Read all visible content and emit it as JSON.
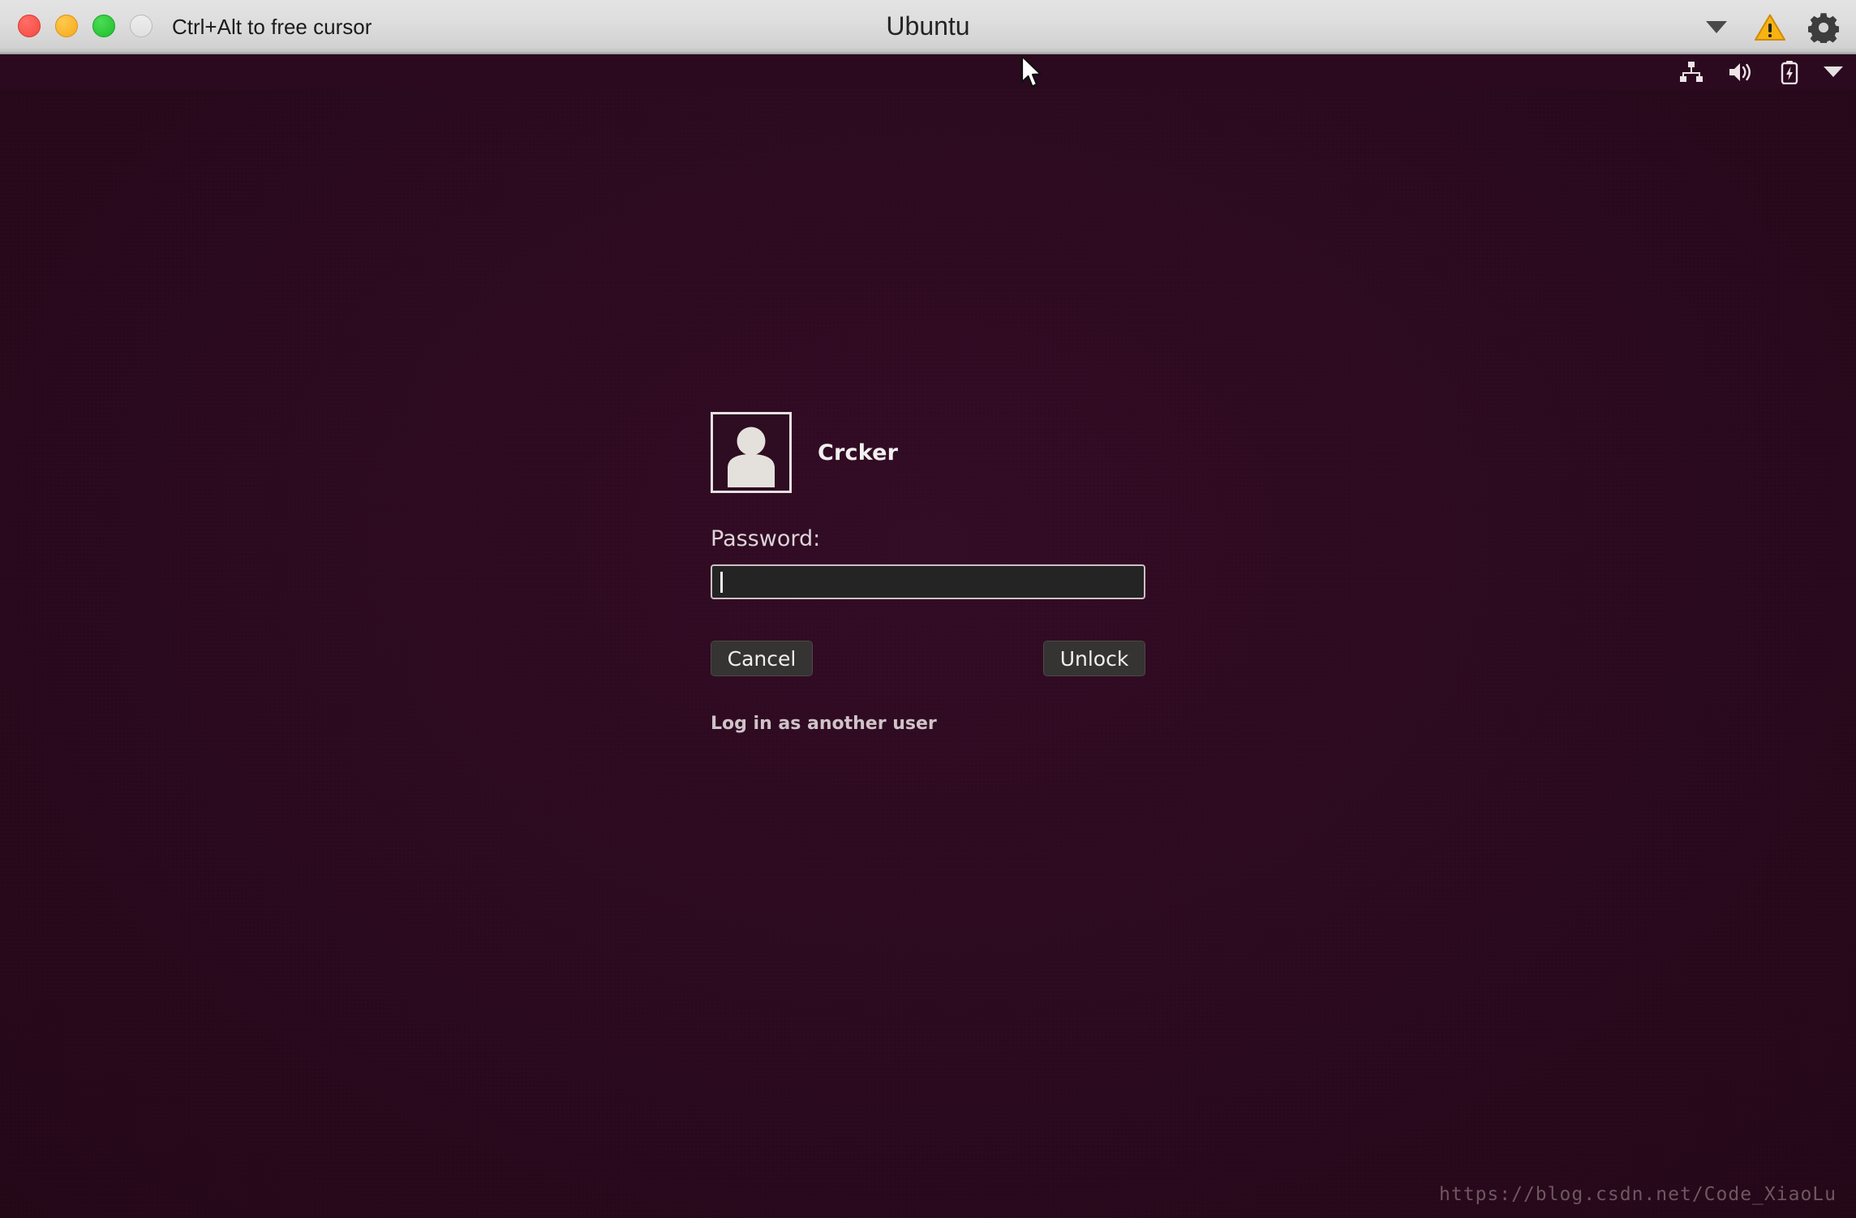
{
  "window": {
    "hint_text": "Ctrl+Alt to free cursor",
    "title": "Ubuntu",
    "traffic_lights": [
      {
        "name": "close",
        "color": "#f4493f"
      },
      {
        "name": "minimize",
        "color": "#f5a81c"
      },
      {
        "name": "maximize",
        "color": "#1fbd2c"
      },
      {
        "name": "inactive",
        "color": "#e0e0e0"
      }
    ],
    "right_icons": [
      {
        "name": "chevron-down-icon",
        "label": "Show toolbar menu"
      },
      {
        "name": "warning-icon",
        "label": "Warning",
        "color": "#f5a623"
      },
      {
        "name": "gear-icon",
        "label": "Settings",
        "color": "#3b3b3b"
      }
    ]
  },
  "panel": {
    "icons": [
      {
        "name": "network-icon",
        "label": "Network"
      },
      {
        "name": "volume-icon",
        "label": "Volume"
      },
      {
        "name": "battery-icon",
        "label": "Battery charging"
      },
      {
        "name": "chevron-down-icon",
        "label": "System menu"
      }
    ]
  },
  "lock_screen": {
    "user": {
      "name": "Crcker",
      "avatar_icon": "user-avatar-icon"
    },
    "password": {
      "label": "Password:",
      "value": "",
      "placeholder": ""
    },
    "buttons": {
      "cancel": "Cancel",
      "unlock": "Unlock"
    },
    "other_user_link": "Log in as another user"
  },
  "watermark": {
    "text": "https://blog.csdn.net/Code_XiaoLu"
  },
  "colors": {
    "desktop_background": "#2b0a1f",
    "titlebar_background": "#d9d9d9",
    "button_background": "#353432",
    "input_background": "#242424",
    "accent_text": "#f2eff0"
  }
}
